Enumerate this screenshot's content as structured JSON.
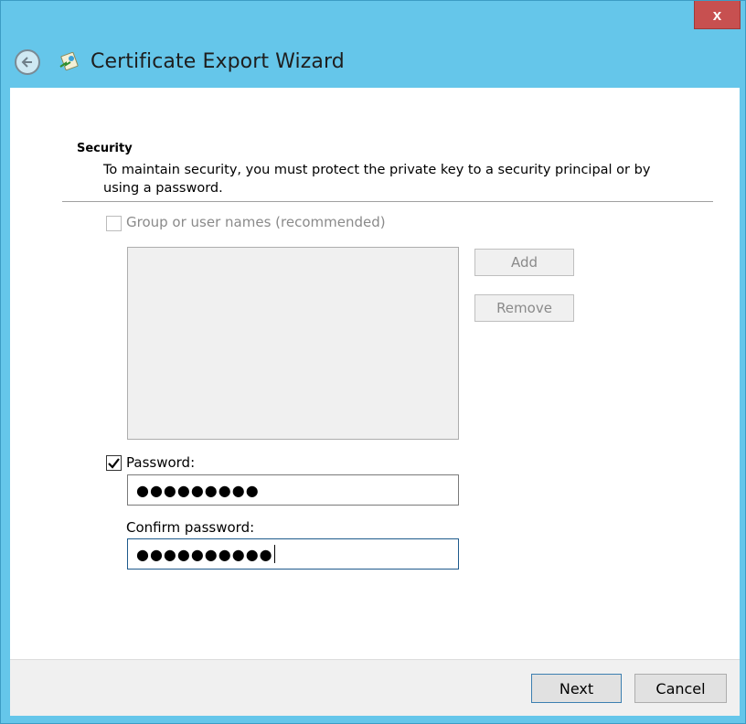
{
  "window": {
    "title": "Certificate Export Wizard",
    "close_label": "x"
  },
  "section": {
    "heading": "Security",
    "description": "To maintain security, you must protect the private key to a security principal or by using a password."
  },
  "group_option": {
    "label": "Group or user names (recommended)",
    "checked": false,
    "enabled": false
  },
  "buttons": {
    "add": "Add",
    "remove": "Remove",
    "next": "Next",
    "cancel": "Cancel"
  },
  "password_option": {
    "label": "Password:",
    "checked": true,
    "value": "●●●●●●●●●"
  },
  "confirm_password": {
    "label": "Confirm password:",
    "value": "●●●●●●●●●●"
  },
  "colors": {
    "frame": "#65c6ea",
    "close": "#c75050"
  }
}
